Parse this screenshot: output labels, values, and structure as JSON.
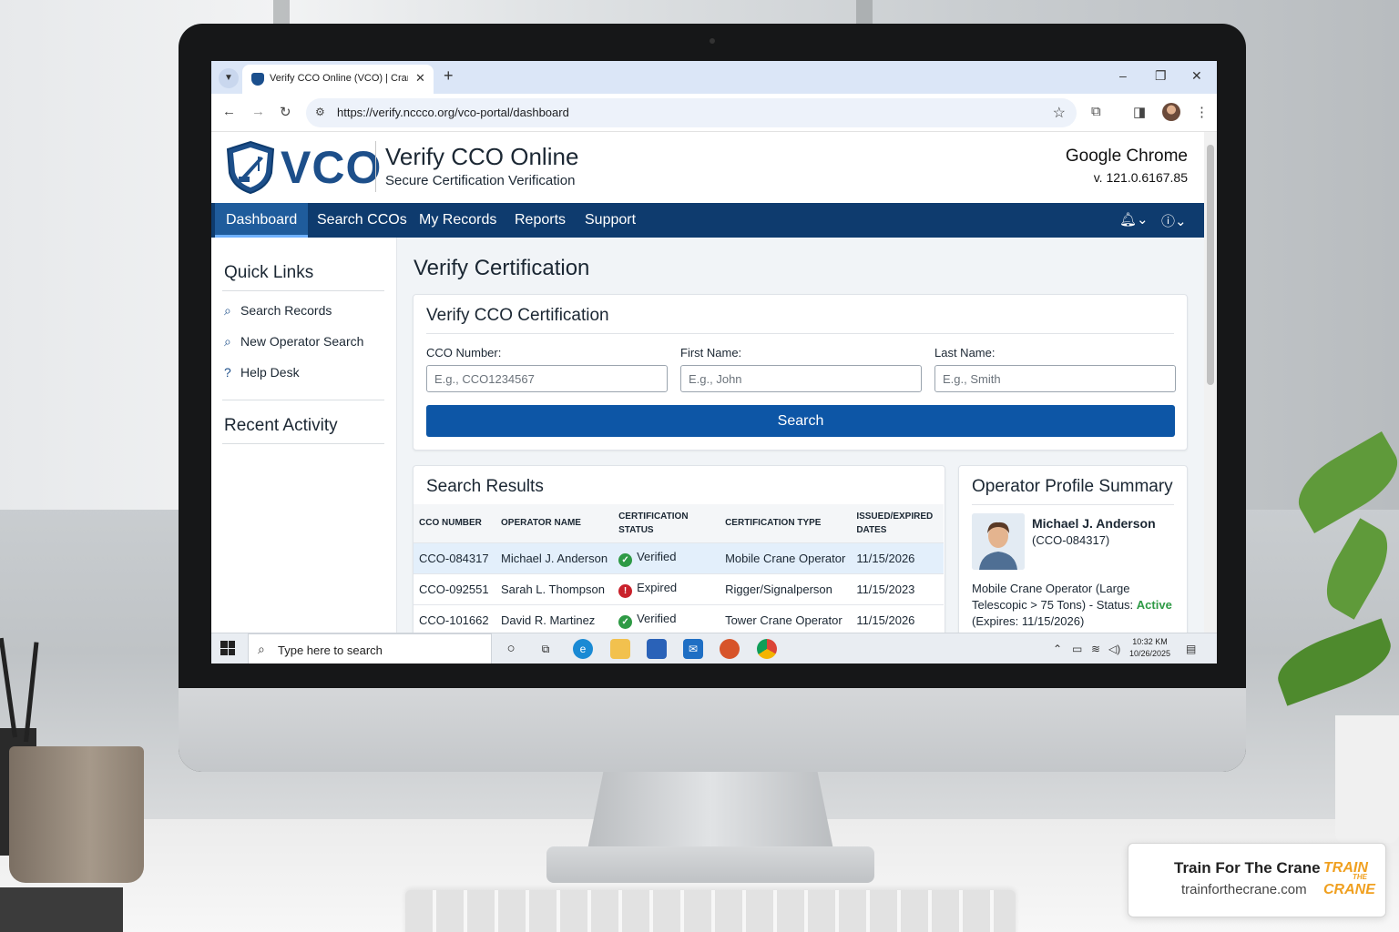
{
  "browser": {
    "tab_title": "Verify CCO Online (VCO) | Cranc",
    "url": "https://verify.nccco.org/vco-portal/dashboard",
    "icons": [
      "tab-search-icon",
      "back-icon",
      "forward-icon",
      "reload-icon",
      "site-settings-icon",
      "bookmark-star-icon",
      "extensions-icon",
      "side-panel-icon",
      "profile-avatar",
      "menu-icon",
      "minimize-icon",
      "restore-icon",
      "close-icon"
    ]
  },
  "site": {
    "logo_text": "VCO",
    "title": "Verify CCO Online",
    "subtitle": "Secure Certification Verification",
    "browser_name": "Google Chrome",
    "browser_version": "v. 121.0.6167.85",
    "brand_color": "#0e3b6e",
    "accent_color": "#0d56a6"
  },
  "nav": {
    "items": [
      {
        "label": "Dashboard",
        "active": true
      },
      {
        "label": "Search CCOs",
        "active": false
      },
      {
        "label": "My Records",
        "active": false
      },
      {
        "label": "Reports",
        "active": false
      },
      {
        "label": "Support",
        "active": false
      }
    ],
    "icons": [
      "bell-icon",
      "help-icon"
    ]
  },
  "sidebar": {
    "quick_links_title": "Quick Links",
    "links": [
      {
        "label": "Search Records",
        "icon": "search-icon"
      },
      {
        "label": "New Operator Search",
        "icon": "search-icon"
      },
      {
        "label": "Help Desk",
        "icon": "help-circle-icon"
      }
    ],
    "recent_activity_title": "Recent Activity"
  },
  "main": {
    "page_title": "Verify Certification",
    "verify_card": {
      "title": "Verify CCO Certification",
      "fields": [
        {
          "label": "CCO Number:",
          "placeholder": "E.g., CCO1234567",
          "value": ""
        },
        {
          "label": "First Name:",
          "placeholder": "E.g., John",
          "value": ""
        },
        {
          "label": "Last Name:",
          "placeholder": "E.g., Smith",
          "value": ""
        }
      ],
      "search_label": "Search"
    },
    "results": {
      "title": "Search Results",
      "columns": [
        "CCO NUMBER",
        "OPERATOR NAME",
        "CERTIFICATION STATUS",
        "CERTIFICATION TYPE",
        "ISSUED/EXPIRED DATES"
      ],
      "rows": [
        {
          "cco": "CCO-084317",
          "name": "Michael J. Anderson",
          "status": "Verified",
          "status_ok": true,
          "type": "Mobile Crane Operator",
          "date": "11/15/2026",
          "selected": true
        },
        {
          "cco": "CCO-092551",
          "name": "Sarah L. Thompson",
          "status": "Expired",
          "status_ok": false,
          "type": "Rigger/Signalperson",
          "date": "11/15/2023",
          "selected": false
        },
        {
          "cco": "CCO-101662",
          "name": "David R. Martinez",
          "status": "Verified",
          "status_ok": true,
          "type": "Tower Crane Operator",
          "date": "11/15/2026",
          "selected": false
        }
      ],
      "status_colors": {
        "verified": "#2e9a45",
        "expired": "#c9212b"
      }
    },
    "profile": {
      "title": "Operator Profile Summary",
      "name": "Michael J. Anderson",
      "id": "(CCO-084317)",
      "desc_prefix": "Mobile Crane Operator (Large Telescopic > 75 Tons) - Status: ",
      "status_word": "Active",
      "desc_suffix": "(Expires: 11/15/2026)"
    }
  },
  "taskbar": {
    "search_placeholder": "Type here to search",
    "time": "10:32 KM",
    "date": "10/26/2025",
    "icons": [
      "windows-start-icon",
      "search-icon",
      "cortana-icon",
      "task-view-icon",
      "edge-icon",
      "file-explorer-icon",
      "store-icon",
      "mail-icon",
      "app-icon",
      "chrome-icon",
      "tray-chevron-icon",
      "battery-icon",
      "wifi-icon",
      "volume-icon",
      "notifications-icon"
    ]
  },
  "brand": {
    "name": "Train For The Crane",
    "url": "trainforthecrane.com",
    "logo_lines": [
      "TRAIN",
      "THE",
      "CRANE"
    ]
  }
}
